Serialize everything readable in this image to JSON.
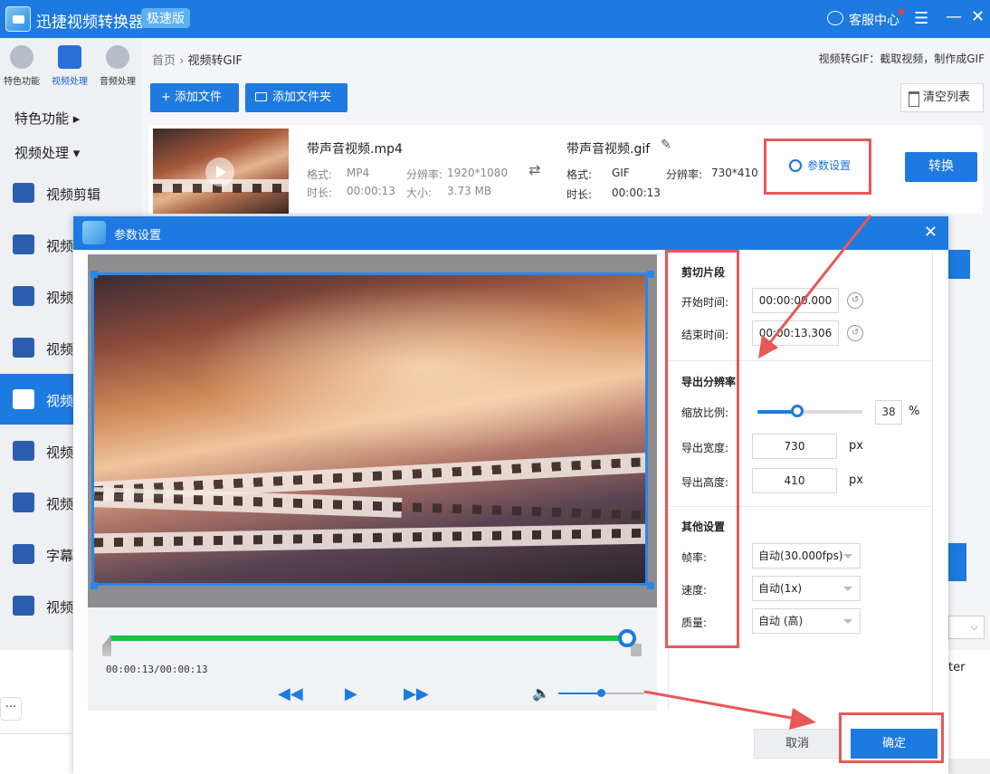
{
  "app": {
    "title": "迅捷视频转换器",
    "badge": "极速版",
    "service_label": "客服中心",
    "menu_icon": "☰",
    "minimize_icon": "—",
    "close_icon": "✕"
  },
  "sidebar": {
    "top_tabs": [
      {
        "label": "特色功能",
        "icon": "star-icon"
      },
      {
        "label": "视频处理",
        "icon": "film-icon"
      },
      {
        "label": "音频处理",
        "icon": "audio-icon"
      }
    ],
    "sections": [
      {
        "label": "特色功能 ▸"
      },
      {
        "label": "视频处理 ▾"
      }
    ],
    "items": [
      {
        "label": "视频剪辑"
      },
      {
        "label": "视频"
      },
      {
        "label": "视频"
      },
      {
        "label": "视频"
      },
      {
        "label": "视频"
      },
      {
        "label": "视频"
      },
      {
        "label": "视频"
      },
      {
        "label": "字幕"
      },
      {
        "label": "视频"
      }
    ]
  },
  "main": {
    "breadcrumb": {
      "home": "首页",
      "sep": "›",
      "current": "视频转GIF"
    },
    "description": "视频转GIF：截取视频，制作成GIF",
    "add_file": "+ 添加文件",
    "add_folder": "添加文件夹",
    "clear_list": "清空列表",
    "file": {
      "source_name": "带声音视频.mp4",
      "format_label": "格式:",
      "format": "MP4",
      "resolution_label": "分辨率:",
      "resolution": "1920*1080",
      "duration_label": "时长:",
      "duration": "00:00:13",
      "size_label": "大小:",
      "size": "3.73 MB",
      "output_name": "带声音视频.gif",
      "output_format_label": "格式:",
      "output_format": "GIF",
      "output_resolution_label": "分辨率:",
      "output_resolution": "730*410",
      "output_duration_label": "时长:",
      "output_duration": "00:00:13",
      "params_button": "参数设置",
      "convert_button": "转换"
    }
  },
  "background_fragments": {
    "more_button": "···",
    "text": "ter"
  },
  "dialog": {
    "title": "参数设置",
    "close_icon": "✕",
    "player": {
      "time": "00:00:13/00:00:13",
      "progress": 1.0,
      "volume": 0.5,
      "rewind_icon": "◀◀",
      "play_icon": "▶",
      "forward_icon": "▶▶",
      "volume_icon": "🔈"
    },
    "cut": {
      "title": "剪切片段",
      "start_label": "开始时间:",
      "start": "00:00:00.000",
      "end_label": "结束时间:",
      "end": "00:00:13.306"
    },
    "resolution": {
      "title": "导出分辨率",
      "scale_label": "缩放比例:",
      "scale": "38",
      "scale_fraction": 0.38,
      "percent_unit": "%",
      "width_label": "导出宽度:",
      "width": "730",
      "height_label": "导出高度:",
      "height": "410",
      "px_unit": "px"
    },
    "other": {
      "title": "其他设置",
      "fps_label": "帧率:",
      "fps": "自动(30.000fps)",
      "speed_label": "速度:",
      "speed": "自动(1x)",
      "quality_label": "质量:",
      "quality": "自动 (高)"
    },
    "cancel": "取消",
    "ok": "确定"
  },
  "colors": {
    "primary": "#1d7ae0",
    "highlight": "#e85858",
    "progress": "#17c63e"
  }
}
